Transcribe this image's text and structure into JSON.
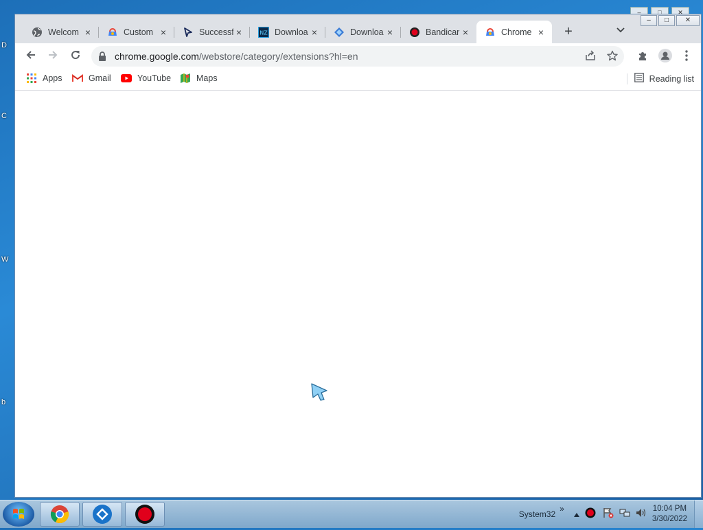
{
  "desktop": {
    "edge_letters": [
      "D",
      "C",
      "W",
      "b"
    ]
  },
  "window": {
    "controls": {
      "minimize": "–",
      "maximize": "□",
      "close": "✕"
    }
  },
  "tabs": [
    {
      "title": "Welcom",
      "icon": "globe-icon",
      "active": false
    },
    {
      "title": "Custom",
      "icon": "chrome-webstore-icon",
      "active": false
    },
    {
      "title": "Successf",
      "icon": "cursor-arrow-icon",
      "active": false
    },
    {
      "title": "Downloa",
      "icon": "download-site-icon",
      "active": false
    },
    {
      "title": "Downloa",
      "icon": "bluestacks-icon",
      "active": false
    },
    {
      "title": "Bandicar",
      "icon": "bandicam-icon",
      "active": false
    },
    {
      "title": "Chrome",
      "icon": "chrome-webstore-icon",
      "active": true
    }
  ],
  "tab_close": "×",
  "new_tab": "+",
  "tab_search": "⌄",
  "toolbar": {
    "url_host": "chrome.google.com",
    "url_path": "/webstore/category/extensions?hl=en"
  },
  "bookmarks": [
    {
      "label": "Apps",
      "icon": "apps-grid-icon"
    },
    {
      "label": "Gmail",
      "icon": "gmail-icon"
    },
    {
      "label": "YouTube",
      "icon": "youtube-icon"
    },
    {
      "label": "Maps",
      "icon": "maps-icon"
    }
  ],
  "reading_list": "Reading list",
  "taskbar": {
    "tray_label": "System32",
    "tray_chevron": "»",
    "time": "10:04 PM",
    "date": "3/30/2022"
  },
  "colors": {
    "tabstrip": "#dee1e6",
    "omnibox": "#f1f3f4",
    "youtube_red": "#ff0000",
    "bandicam_red": "#e0001b"
  }
}
